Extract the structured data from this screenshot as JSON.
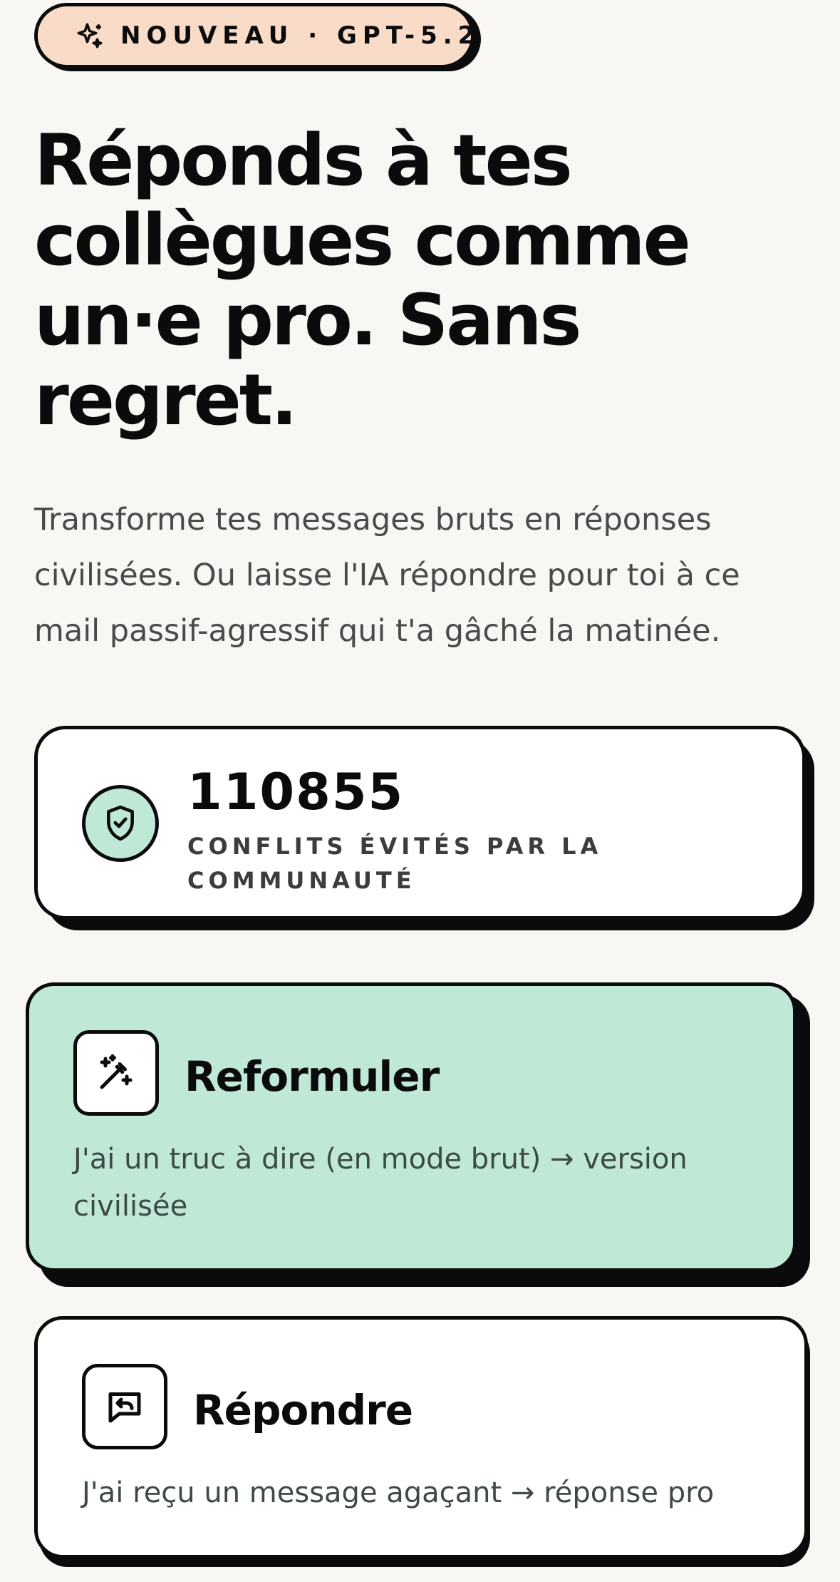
{
  "badge": {
    "icon": "sparkle-icon",
    "label": "NOUVEAU · GPT-5.2",
    "color": "#f9dcc7"
  },
  "hero": {
    "title": "Réponds à tes\ncollègues comme\nun·e pro. Sans\nregret.",
    "subtitle": "Transforme tes messages bruts en réponses\ncivilisées. Ou laisse l'IA répondre pour toi à ce\nmail passif-agressif qui t'a gâché la matinée."
  },
  "stats": {
    "icon": "shield-check-icon",
    "number": "110855",
    "label": "CONFLITS ÉVITÉS PAR LA\nCOMMUNAUTÉ",
    "accent": "#bfe8d7"
  },
  "actions": [
    {
      "icon": "magic-wand-icon",
      "title": "Reformuler",
      "description": "J'ai un truc à dire (en mode brut) → version\ncivilisée",
      "background": "#bfe8d7"
    },
    {
      "icon": "reply-message-icon",
      "title": "Répondre",
      "description": "J'ai reçu un message agaçant → réponse pro",
      "background": "#ffffff"
    }
  ]
}
